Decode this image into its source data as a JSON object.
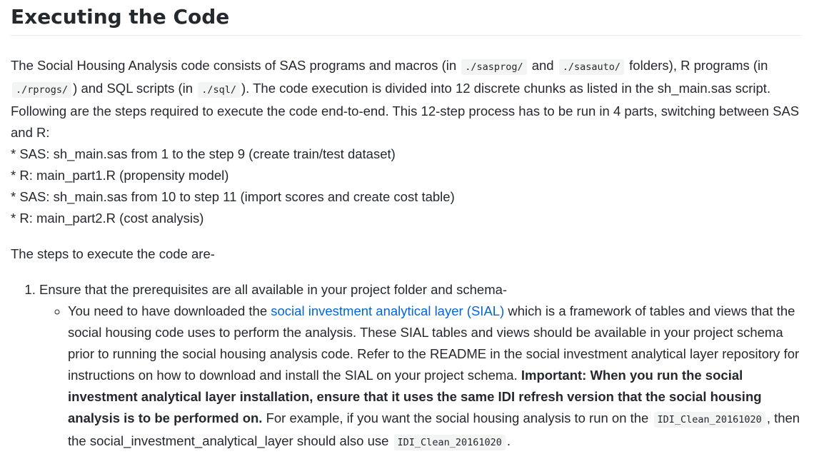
{
  "heading": "Executing the Code",
  "intro": {
    "t1": "The Social Housing Analysis code consists of SAS programs and macros (in",
    "code1": "./sasprog/",
    "t2": "and",
    "code2": "./sasauto/",
    "t3": "folders), R programs (in",
    "code3": "./rprogs/",
    "t4": ") and SQL scripts (in",
    "code4": "./sql/",
    "t5": "). The code execution is divided into 12 discrete chunks as listed in the sh_main.sas script. Following are the steps required to execute the code end-to-end. This 12-step process has to be run in 4 parts, switching between SAS and R:",
    "bullets": [
      "* SAS: sh_main.sas from 1 to the step 9 (create train/test dataset)",
      "* R: main_part1.R (propensity model)",
      "* SAS: sh_main.sas from 10 to step 11 (import scores and create cost table)",
      "* R: main_part2.R (cost analysis)"
    ]
  },
  "steps_intro": "The steps to execute the code are-",
  "steps": [
    {
      "text": "Ensure that the prerequisites are all available in your project folder and schema-",
      "subitems": [
        {
          "t1": "You need to have downloaded the",
          "link": "social investment analytical layer (SIAL)",
          "t2": "which is a framework of tables and views that the social housing code uses to perform the analysis. These SIAL tables and views should be available in your project schema prior to running the social housing analysis code. Refer to the README in the social investment analytical layer repository for instructions on how to download and install the SIAL on your project schema.",
          "strong": "Important: When you run the social investment analytical layer installation, ensure that it uses the same IDI refresh version that the social housing analysis is to be performed on.",
          "t3": "For example, if you want the social housing analysis to run on the",
          "code1": "IDI_Clean_20161020",
          "t4": ", then the social_investment_analytical_layer should also use",
          "code2": "IDI_Clean_20161020",
          "t5": "."
        }
      ]
    }
  ]
}
